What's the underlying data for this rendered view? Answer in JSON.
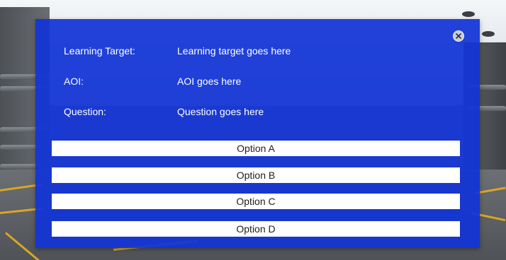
{
  "dialog": {
    "rows": [
      {
        "label": "Learning Target:",
        "value": "Learning target goes here"
      },
      {
        "label": "AOI:",
        "value": "AOI goes here"
      },
      {
        "label": "Question:",
        "value": "Question goes here"
      }
    ],
    "options": [
      "Option A",
      "Option B",
      "Option C",
      "Option D"
    ],
    "close_icon": "close-icon"
  },
  "colors": {
    "dialog_background": "#1134d6",
    "option_background": "#ffffff",
    "text_on_dialog": "#ffffff",
    "lane_marking": "#d8a623"
  }
}
